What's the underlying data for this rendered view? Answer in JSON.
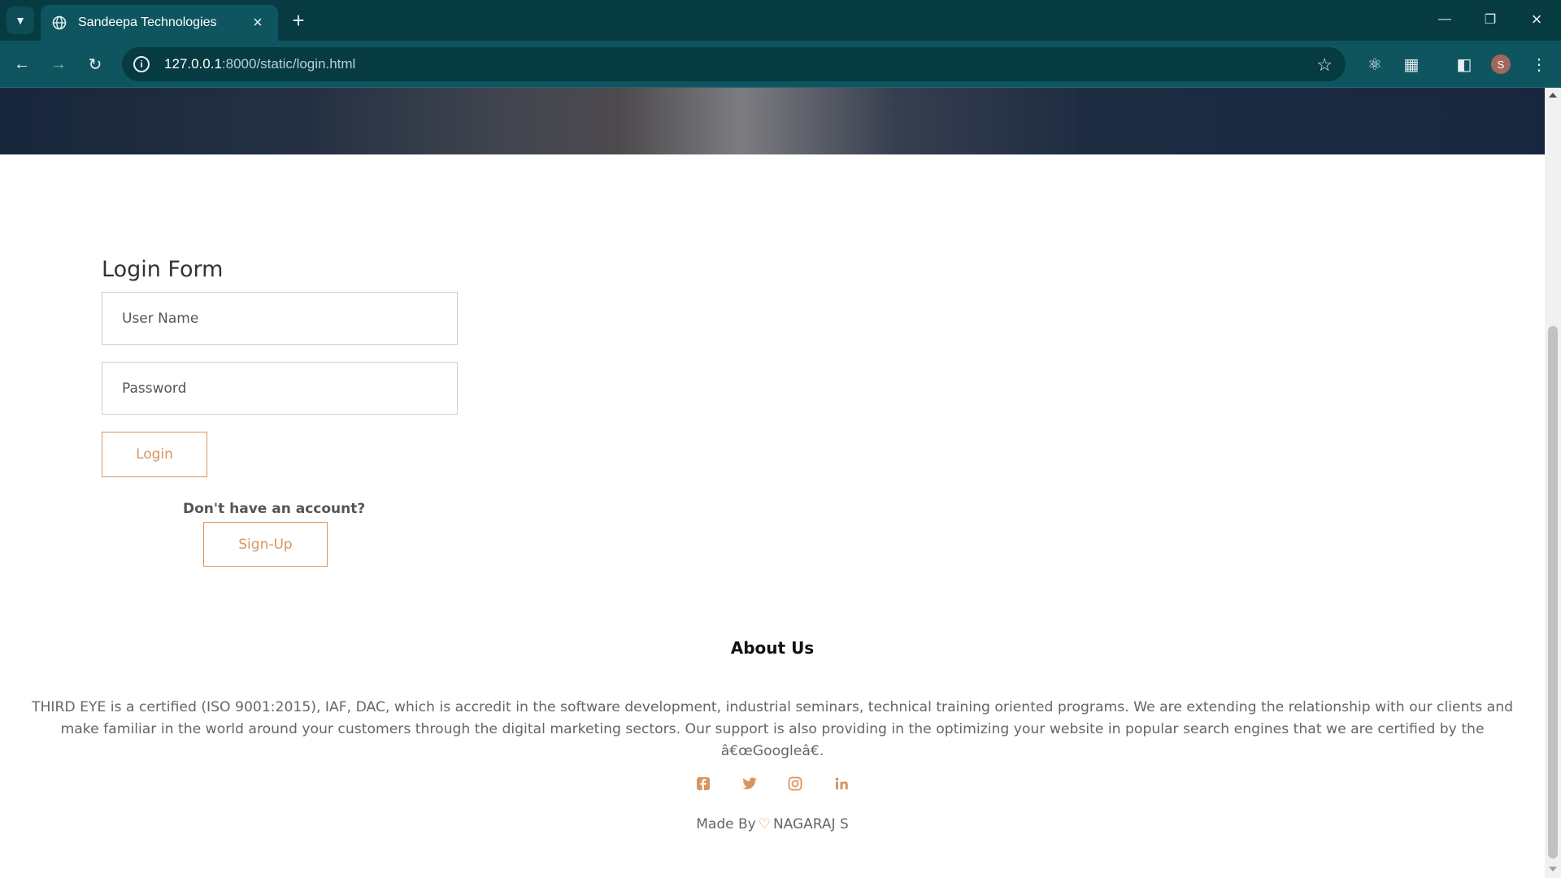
{
  "browser": {
    "tab_title": "Sandeepa Technologies",
    "url_host": "127.0.0.1",
    "url_path": ":8000/static/login.html",
    "profile_initial": "S"
  },
  "login": {
    "title": "Login Form",
    "username_placeholder": "User Name",
    "password_placeholder": "Password",
    "login_label": "Login",
    "no_account_text": "Don't have an account?",
    "signup_label": "Sign-Up"
  },
  "about": {
    "title": "About Us",
    "text": "THIRD EYE is a certified (ISO 9001:2015), IAF, DAC, which is accredit in the software development, industrial seminars, technical training oriented programs. We are extending the relationship with our clients and make familiar in the world around your customers through the digital marketing sectors. Our support is also providing in the optimizing your website in popular search engines that we are certified by the â€œGoogleâ€."
  },
  "socials": [
    "facebook-icon",
    "twitter-icon",
    "instagram-icon",
    "linkedin-icon"
  ],
  "footer": {
    "made_by": "Made By",
    "author": "NAGARAJ S"
  },
  "colors": {
    "accent": "#d9955f",
    "chrome_dark": "#063b42",
    "chrome_toolbar": "#0f5560"
  }
}
